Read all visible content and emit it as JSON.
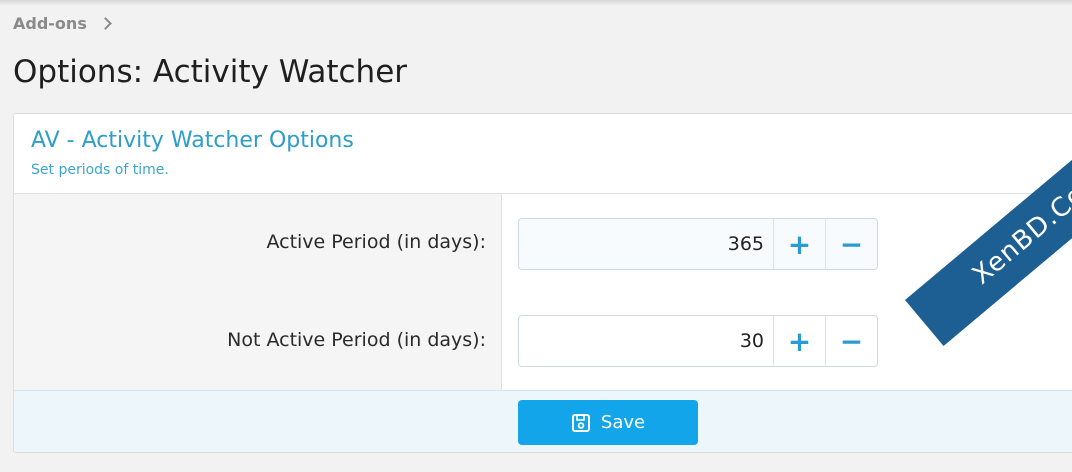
{
  "breadcrumb": {
    "item": "Add-ons"
  },
  "page": {
    "title": "Options: Activity Watcher"
  },
  "block": {
    "title": "AV - Activity Watcher Options",
    "description": "Set periods of time."
  },
  "fields": [
    {
      "label": "Active Period (in days):",
      "value": "365",
      "increment": "+",
      "decrement": "−"
    },
    {
      "label": "Not Active Period (in days):",
      "value": "30",
      "increment": "+",
      "decrement": "−"
    }
  ],
  "footer": {
    "save_label": "Save"
  },
  "watermark": {
    "text": "XenBD.Com"
  },
  "colors": {
    "accent": "#2d9dc9",
    "button": "#12a5ea",
    "watermark": "#1d5f93"
  },
  "icons": {
    "save": "floppy-disk-icon",
    "breadcrumb_chevron": "chevron-right-icon"
  }
}
